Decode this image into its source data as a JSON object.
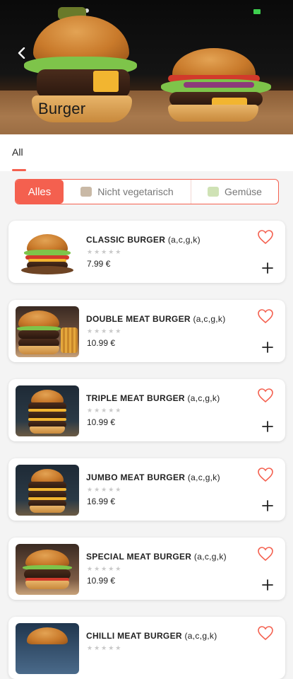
{
  "header": {
    "title": "Burger",
    "back_icon": "back-arrow-icon"
  },
  "tabs": [
    {
      "label": "All",
      "active": true
    }
  ],
  "filters": [
    {
      "label": "Alles",
      "active": true
    },
    {
      "label": "Nicht vegetarisch",
      "icon": "meat-icon"
    },
    {
      "label": "Gemüse",
      "icon": "vegetable-icon"
    }
  ],
  "colors": {
    "accent": "#f4604f",
    "card_bg": "#ffffff",
    "page_bg": "#f4f4f4"
  },
  "products": [
    {
      "name": "CLASSIC BURGER",
      "allergens": "(a,c,g,k)",
      "stars": "★★★★★",
      "price": "7.99 €"
    },
    {
      "name": "DOUBLE MEAT BURGER",
      "allergens": "(a,c,g,k)",
      "stars": "★★★★★",
      "price": "10.99 €"
    },
    {
      "name": "TRIPLE MEAT BURGER",
      "allergens": "(a,c,g,k)",
      "stars": "★★★★★",
      "price": "10.99 €"
    },
    {
      "name": "JUMBO MEAT BURGER",
      "allergens": "(a,c,g,k)",
      "stars": "★★★★★",
      "price": "16.99 €"
    },
    {
      "name": "SPECIAL MEAT BURGER",
      "allergens": "(a,c,g,k)",
      "stars": "★★★★★",
      "price": "10.99 €"
    },
    {
      "name": "CHILLI MEAT BURGER",
      "allergens": "(a,c,g,k)",
      "stars": "★★★★★",
      "price": ""
    }
  ]
}
